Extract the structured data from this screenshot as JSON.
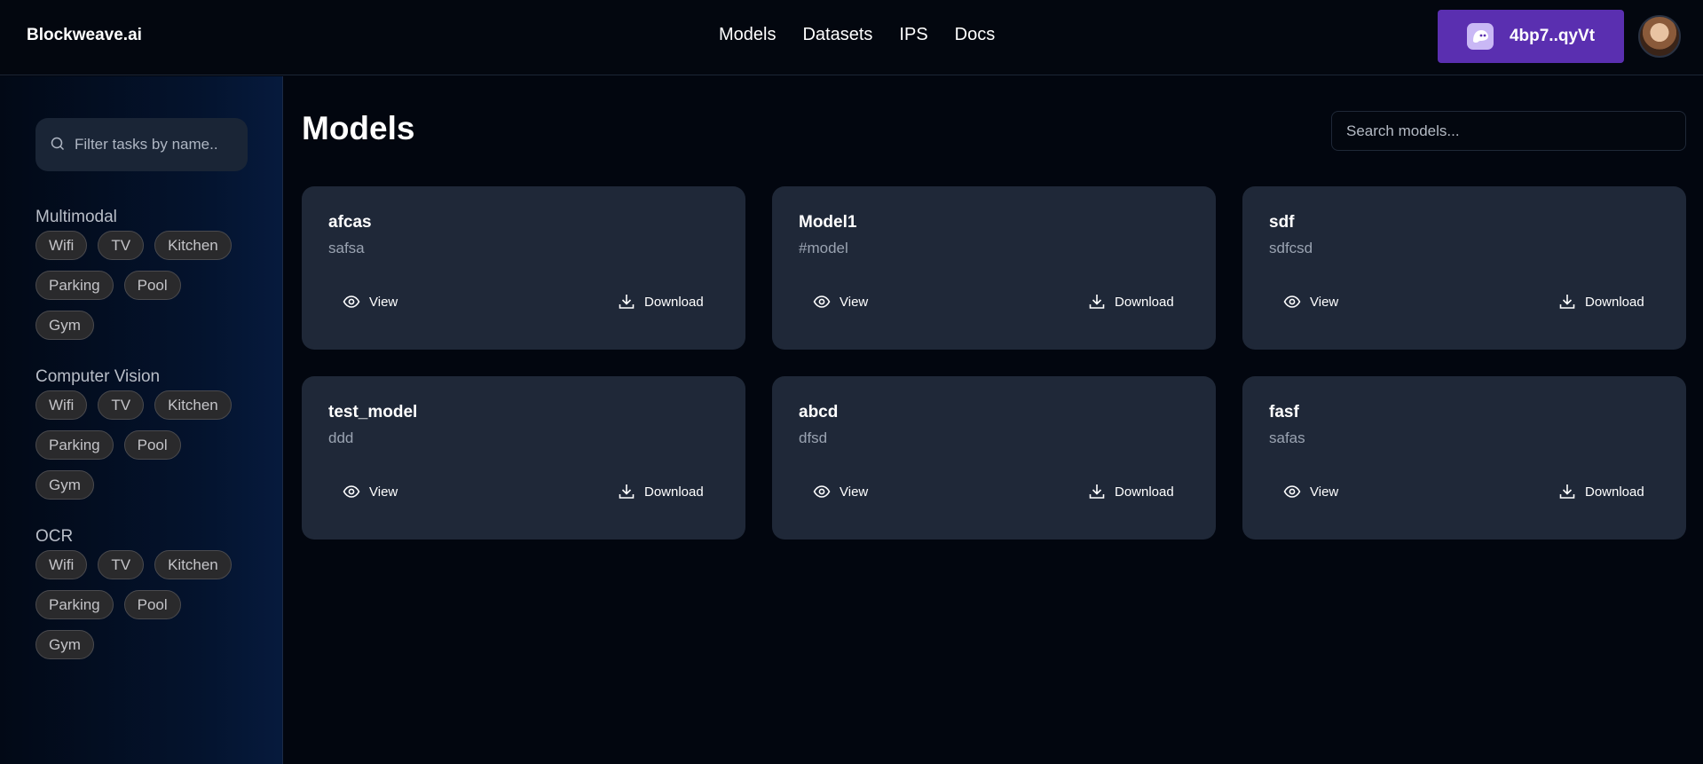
{
  "app": {
    "brand": "Blockweave.ai"
  },
  "nav": {
    "items": [
      "Models",
      "Datasets",
      "IPS",
      "Docs"
    ]
  },
  "wallet": {
    "label": "4bp7..qyVt",
    "icon": "ghost-icon",
    "color": "#5a2fb0"
  },
  "sidebar": {
    "filter_placeholder": "Filter tasks by name..",
    "sections": [
      {
        "title": "Multimodal",
        "tags": [
          "Wifi",
          "TV",
          "Kitchen",
          "Parking",
          "Pool",
          "Gym"
        ]
      },
      {
        "title": "Computer Vision",
        "tags": [
          "Wifi",
          "TV",
          "Kitchen",
          "Parking",
          "Pool",
          "Gym"
        ]
      },
      {
        "title": "OCR",
        "tags": [
          "Wifi",
          "TV",
          "Kitchen",
          "Parking",
          "Pool",
          "Gym"
        ]
      }
    ]
  },
  "main": {
    "title": "Models",
    "search_placeholder": "Search models...",
    "view_label": "View",
    "download_label": "Download",
    "models": [
      {
        "name": "afcas",
        "description": "safsa"
      },
      {
        "name": "Model1",
        "description": "#model"
      },
      {
        "name": "sdf",
        "description": "sdfcsd"
      },
      {
        "name": "test_model",
        "description": "ddd"
      },
      {
        "name": "abcd",
        "description": "dfsd"
      },
      {
        "name": "fasf",
        "description": "safas"
      }
    ]
  }
}
